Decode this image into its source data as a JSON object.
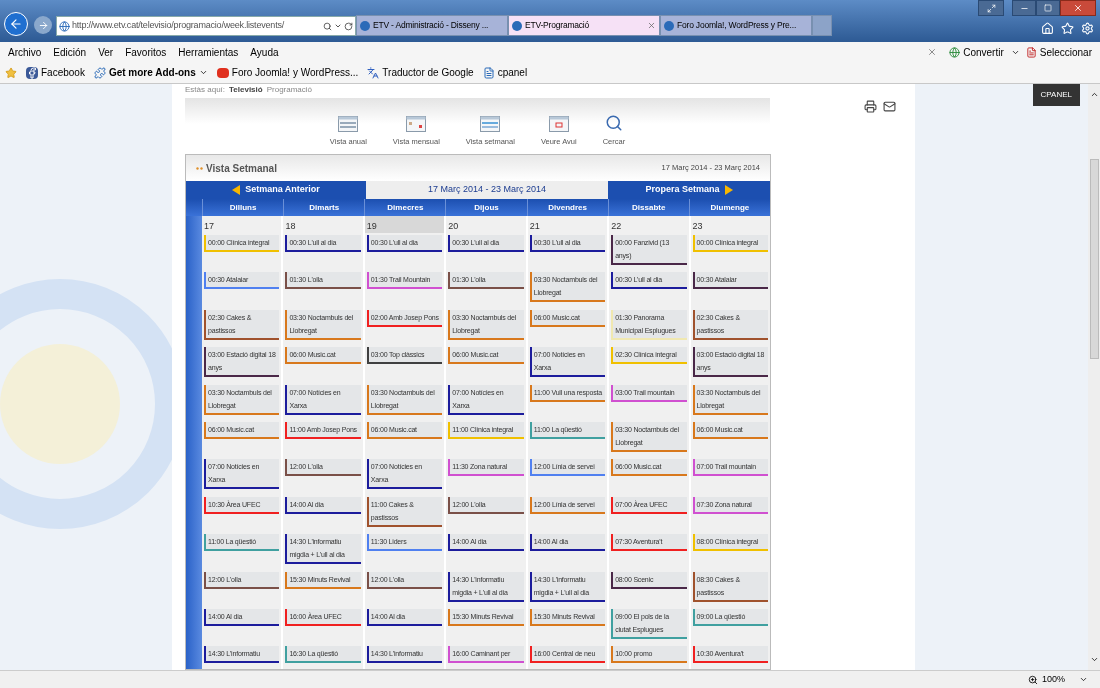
{
  "browser": {
    "address": "http://www.etv.cat/televisio/programacio/week.listevents/",
    "tabs": [
      {
        "title": "ETV - Administració - Disseny ...",
        "selected": false
      },
      {
        "title": "ETV-Programació",
        "selected": true
      },
      {
        "title": "Foro Joomla!, WordPress y Pre...",
        "selected": false
      }
    ],
    "menu": [
      "Archivo",
      "Edición",
      "Ver",
      "Favoritos",
      "Herramientas",
      "Ayuda"
    ],
    "menu_right": [
      {
        "label": "Convertir",
        "kind": "convert"
      },
      {
        "label": "Seleccionar",
        "kind": "select"
      }
    ],
    "favorites": [
      {
        "label": "Facebook",
        "kind": "facebook"
      },
      {
        "label": "Get more Add-ons",
        "kind": "addons"
      },
      {
        "label": "Foro Joomla! y WordPress...",
        "kind": "forum"
      },
      {
        "label": "Traductor de Google",
        "kind": "translate"
      },
      {
        "label": "cpanel",
        "kind": "page"
      }
    ]
  },
  "page": {
    "breadcrumb": [
      "Estàs aquí:",
      "Televisió",
      "Programació"
    ],
    "cpanel": "CPANEL",
    "views": [
      {
        "label": "Vista anual",
        "kind": "year"
      },
      {
        "label": "Vista mensual",
        "kind": "month"
      },
      {
        "label": "Vista setmanal",
        "kind": "week"
      },
      {
        "label": "Veure Avui",
        "kind": "today"
      },
      {
        "label": "Cercar",
        "kind": "search"
      }
    ],
    "calendar": {
      "title": "Vista Setmanal",
      "range": "17 Març 2014 - 23 Març 2014",
      "prev": "Setmana Anterior",
      "current": "17 Març 2014 - 23 Març 2014",
      "next": "Propera Setmana",
      "days": [
        {
          "name": "Dilluns",
          "date": "17",
          "selected": false
        },
        {
          "name": "Dimarts",
          "date": "18",
          "selected": false
        },
        {
          "name": "Dimecres",
          "date": "19",
          "selected": true
        },
        {
          "name": "Dijous",
          "date": "20",
          "selected": false
        },
        {
          "name": "Divendres",
          "date": "21",
          "selected": false
        },
        {
          "name": "Dissabte",
          "date": "22",
          "selected": false
        },
        {
          "name": "Diumenge",
          "date": "23",
          "selected": false
        }
      ],
      "rows": [
        [
          {
            "text": "00:00 Clínica integral",
            "color": "#f0c000"
          },
          {
            "text": "00:30 L'ull al dia",
            "color": "#1c1c9c"
          },
          {
            "text": "00:30 L'ull al dia",
            "color": "#1c1c9c"
          },
          {
            "text": "00:30 L'ull al dia",
            "color": "#1c1c9c"
          },
          {
            "text": "00:30 L'ull al dia",
            "color": "#1c1c9c"
          },
          {
            "text": "00:00 Fanzivid (13 anys)",
            "color": "#4a2848"
          },
          {
            "text": "00:00 Clínica integral",
            "color": "#f0c000"
          }
        ],
        [
          {
            "text": "00:30 Atalaiar",
            "color": "#5080f0"
          },
          {
            "text": "01:30 L'olla",
            "color": "#7a5048"
          },
          {
            "text": "01:30 Trail Mountain",
            "color": "#d050d0"
          },
          {
            "text": "01:30 L'olla",
            "color": "#7a5048"
          },
          {
            "text": "03:30 Noctambuls del Llobregat",
            "color": "#d8781c"
          },
          {
            "text": "00:30 L'ull al dia",
            "color": "#1c1c9c"
          },
          {
            "text": "00:30 Atalaiar",
            "color": "#4a2848"
          }
        ],
        [
          {
            "text": "02:30 Cakes & pastissos",
            "color": "#a0522d"
          },
          {
            "text": "03:30 Noctambuls del Llobregat",
            "color": "#d8781c"
          },
          {
            "text": "02:00 Amb Josep Pons",
            "color": "#f02020"
          },
          {
            "text": "03:30 Noctambuls del Llobregat",
            "color": "#d8781c"
          },
          {
            "text": "06:00 Music.cat",
            "color": "#d8781c"
          },
          {
            "text": "01:30 Panorama Municipal Esplugues",
            "color": "#f0e8b0"
          },
          {
            "text": "02:30 Cakes & pastissos",
            "color": "#a0522d"
          }
        ],
        [
          {
            "text": "03:00 Estació digital 18 anys",
            "color": "#4a2848"
          },
          {
            "text": "06:00 Music.cat",
            "color": "#d8781c"
          },
          {
            "text": "03:00 Top clàssics",
            "color": "#404040"
          },
          {
            "text": "06:00 Music.cat",
            "color": "#d8781c"
          },
          {
            "text": "07:00 Notícies en Xarxa",
            "color": "#1c1c9c"
          },
          {
            "text": "02:30 Clínica integral",
            "color": "#f0c000"
          },
          {
            "text": "03:00 Estació digital 18 anys",
            "color": "#4a2848"
          }
        ],
        [
          {
            "text": "03:30 Noctambuls del Llobregat",
            "color": "#d8781c"
          },
          {
            "text": "07:00 Notícies en Xarxa",
            "color": "#1c1c9c"
          },
          {
            "text": "03:30 Noctambuls del Llobregat",
            "color": "#d8781c"
          },
          {
            "text": "07:00 Notícies en Xarxa",
            "color": "#1c1c9c"
          },
          {
            "text": "11:00 Vull una resposta",
            "color": "#d8781c"
          },
          {
            "text": "03:00 Trail mountain",
            "color": "#d050d0"
          },
          {
            "text": "03:30 Noctambuls del Llobregat",
            "color": "#d8781c"
          }
        ],
        [
          {
            "text": "06:00 Music.cat",
            "color": "#d8781c"
          },
          {
            "text": "11:00 Amb Josep Pons",
            "color": "#f02020"
          },
          {
            "text": "06:00 Music.cat",
            "color": "#d8781c"
          },
          {
            "text": "11:00 Clínica integral",
            "color": "#f0c000"
          },
          {
            "text": "11:00 La qüestió",
            "color": "#40a0a0"
          },
          {
            "text": "03:30 Noctambuls del Llobregat",
            "color": "#d8781c"
          },
          {
            "text": "06:00 Music.cat",
            "color": "#d8781c"
          }
        ],
        [
          {
            "text": "07:00 Notícies en Xarxa",
            "color": "#1c1c9c"
          },
          {
            "text": "12:00 L'olla",
            "color": "#7a5048"
          },
          {
            "text": "07:00 Notícies en Xarxa",
            "color": "#1c1c9c"
          },
          {
            "text": "11:30 Zona natural",
            "color": "#d050d0"
          },
          {
            "text": "12:00 Línia de servei",
            "color": "#5080f0"
          },
          {
            "text": "06:00 Music.cat",
            "color": "#d8781c"
          },
          {
            "text": "07:00 Trail mountain",
            "color": "#d050d0"
          }
        ],
        [
          {
            "text": "10:30 Àrea UFEC",
            "color": "#f02020"
          },
          {
            "text": "14:00 Al dia",
            "color": "#1c1c9c"
          },
          {
            "text": "11:00 Cakes & pastissos",
            "color": "#a0522d"
          },
          {
            "text": "12:00 L'olla",
            "color": "#7a5048"
          },
          {
            "text": "12:00 Línia de servei",
            "color": "#d8781c"
          },
          {
            "text": "07:00 Àrea UFEC",
            "color": "#f02020"
          },
          {
            "text": "07:30 Zona natural",
            "color": "#d050d0"
          }
        ],
        [
          {
            "text": "11:00 La qüestió",
            "color": "#40a0a0"
          },
          {
            "text": "14:30 L'informatiu migdia + L'ull al dia",
            "color": "#1c1c9c"
          },
          {
            "text": "11:30 Liders",
            "color": "#5080f0"
          },
          {
            "text": "14:00 Al dia",
            "color": "#1c1c9c"
          },
          {
            "text": "14:00 Al dia",
            "color": "#1c1c9c"
          },
          {
            "text": "07:30 Aventura't",
            "color": "#f02020"
          },
          {
            "text": "08:00 Clínica integral",
            "color": "#f0c000"
          }
        ],
        [
          {
            "text": "12:00 L'olla",
            "color": "#7a5048"
          },
          {
            "text": "15:30 Minuts Revival",
            "color": "#d8781c"
          },
          {
            "text": "12:00 L'olla",
            "color": "#7a5048"
          },
          {
            "text": "14:30 L'informatiu migdia + L'ull al dia",
            "color": "#1c1c9c"
          },
          {
            "text": "14:30 L'informatiu migdia + L'ull al dia",
            "color": "#1c1c9c"
          },
          {
            "text": "08:00 Scenic",
            "color": "#4a2848"
          },
          {
            "text": "08:30 Cakes & pastissos",
            "color": "#a0522d"
          }
        ],
        [
          {
            "text": "14:00 Al dia",
            "color": "#1c1c9c"
          },
          {
            "text": "16:00 Àrea UFEC",
            "color": "#f02020"
          },
          {
            "text": "14:00 Al dia",
            "color": "#1c1c9c"
          },
          {
            "text": "15:30 Minuts Revival",
            "color": "#d8781c"
          },
          {
            "text": "15:30 Minuts Revival",
            "color": "#d8781c"
          },
          {
            "text": "09:00 El pols de la ciutat Esplugues",
            "color": "#40a0a0"
          },
          {
            "text": "09:00 La qüestió",
            "color": "#40a0a0"
          }
        ],
        [
          {
            "text": "14:30 L'informatiu",
            "color": "#1c1c9c"
          },
          {
            "text": "16:30 La qüestió",
            "color": "#40a0a0"
          },
          {
            "text": "14:30 L'informatiu",
            "color": "#1c1c9c"
          },
          {
            "text": "16:00 Caminant per",
            "color": "#d050d0"
          },
          {
            "text": "16:00 Central de neu",
            "color": "#f02020"
          },
          {
            "text": "10:00 promo",
            "color": "#d8781c"
          },
          {
            "text": "10:30 Aventura't",
            "color": "#f02020"
          }
        ]
      ]
    }
  },
  "status_bar": {
    "zoom": "100%"
  }
}
